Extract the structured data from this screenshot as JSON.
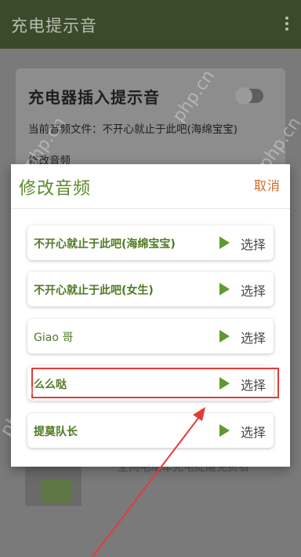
{
  "app": {
    "title": "充电提示音",
    "menu_icon": "more-vert-icon"
  },
  "background_card": {
    "title": "充电器插入提示音",
    "audio_file_line": "当前音频文件：不开心就止于此吧(海绵宝宝)",
    "change_audio_row": "修改音频",
    "bottom_text": "全网电动车充电提醒免费看"
  },
  "dialog": {
    "title": "修改音频",
    "cancel_label": "取消",
    "options": [
      {
        "name": "不开心就止于此吧(海绵宝宝)",
        "select_label": "选择"
      },
      {
        "name": "不开心就止于此吧(女生)",
        "select_label": "选择"
      },
      {
        "name": "Giao 哥",
        "select_label": "选择"
      },
      {
        "name": "么么哒",
        "select_label": "选择"
      },
      {
        "name": "提莫队长",
        "select_label": "选择"
      }
    ]
  },
  "watermarks": [
    "php.cn",
    "php.cn",
    "php.cn",
    "php.cn"
  ],
  "colors": {
    "accent": "#5a8a2a",
    "cancel": "#d2691e",
    "highlight": "#e53a3a"
  }
}
